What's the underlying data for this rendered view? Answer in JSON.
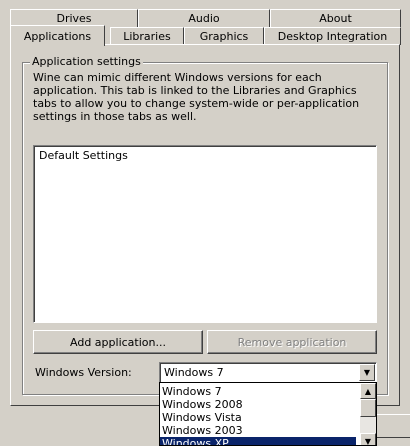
{
  "tabs": {
    "row_back": [
      {
        "label": "Drives"
      },
      {
        "label": "Audio"
      },
      {
        "label": "About"
      }
    ],
    "row_front": [
      {
        "label": "Applications"
      },
      {
        "label": "Libraries"
      },
      {
        "label": "Graphics"
      },
      {
        "label": "Desktop Integration"
      }
    ],
    "selected": "Applications"
  },
  "app_settings": {
    "group_title": "Application settings",
    "description": "Wine can mimic different Windows versions for each application. This tab is linked to the Libraries and Graphics tabs to allow you to change system-wide or per-application settings in those tabs as well.",
    "list_items": [
      "Default Settings"
    ],
    "add_button": "Add application...",
    "remove_button": "Remove application",
    "windows_version_label": "Windows Version:",
    "windows_version_value": "Windows 7",
    "version_options": [
      "Windows 7",
      "Windows 2008",
      "Windows Vista",
      "Windows 2003",
      "Windows XP"
    ],
    "highlighted_option": "Windows XP"
  },
  "icons": {
    "dropdown_arrow": "chevron-down-icon",
    "scroll_up": "chevron-up-icon",
    "scroll_down": "chevron-down-icon"
  },
  "colors": {
    "face": "#d4d0c8",
    "highlight": "#0a246a"
  }
}
